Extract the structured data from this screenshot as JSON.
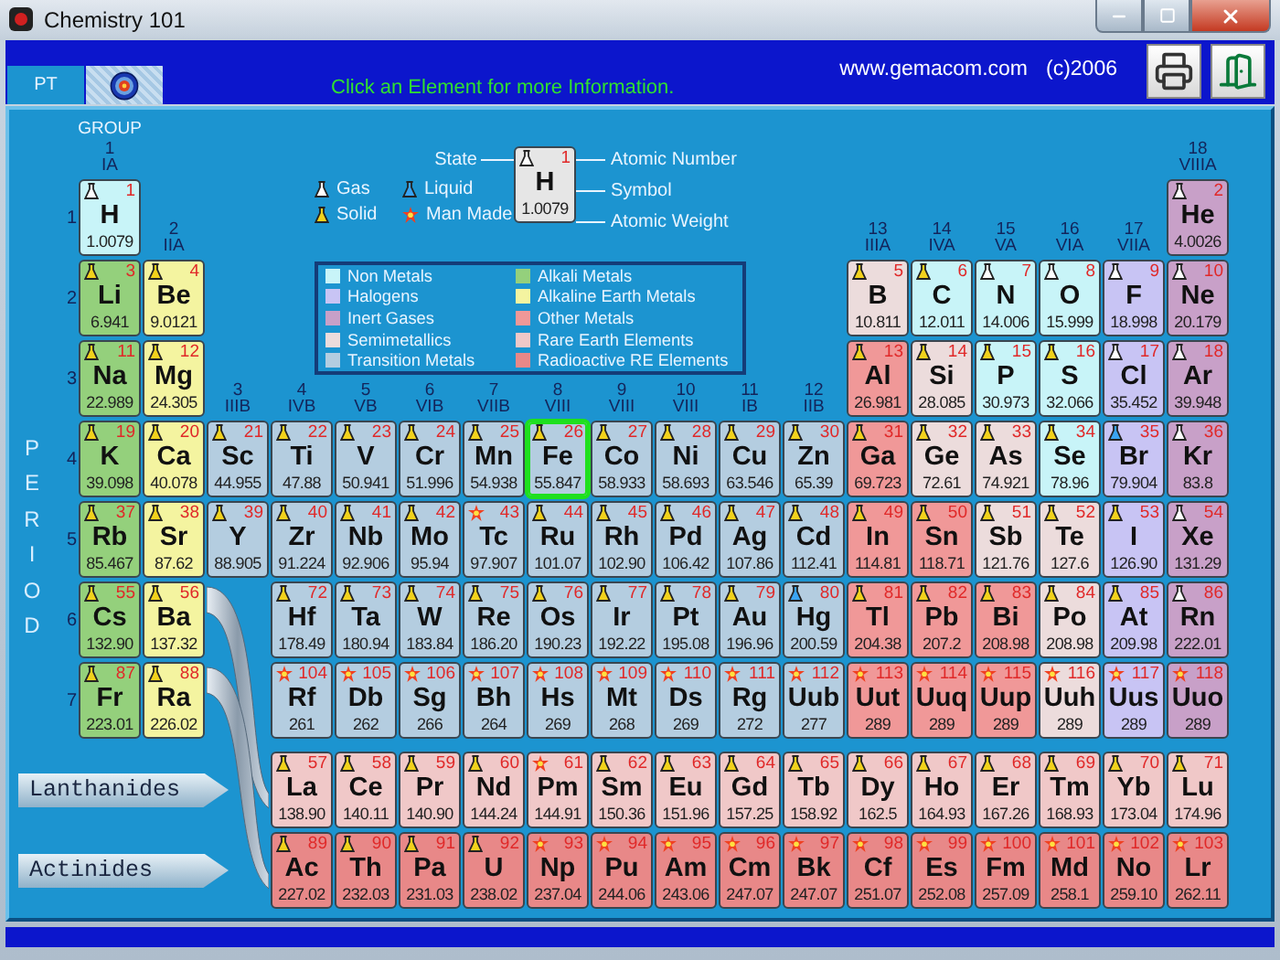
{
  "window": {
    "title": "Chemistry 101"
  },
  "tabs": [
    {
      "label": "PT",
      "selected": true
    },
    {
      "selected": false
    }
  ],
  "header": {
    "hint": "Click an Element for more Information.",
    "website": "www.gemacom.com",
    "copyright": "(c)2006"
  },
  "group_heading": "GROUP",
  "groups": [
    {
      "number": "1",
      "roman": "IA"
    },
    {
      "number": "2",
      "roman": "IIA"
    },
    {
      "number": "3",
      "roman": "IIIB"
    },
    {
      "number": "4",
      "roman": "IVB"
    },
    {
      "number": "5",
      "roman": "VB"
    },
    {
      "number": "6",
      "roman": "VIB"
    },
    {
      "number": "7",
      "roman": "VIIB"
    },
    {
      "number": "8",
      "roman": "VIII"
    },
    {
      "number": "9",
      "roman": "VIII"
    },
    {
      "number": "10",
      "roman": "VIII"
    },
    {
      "number": "11",
      "roman": "IB"
    },
    {
      "number": "12",
      "roman": "IIB"
    },
    {
      "number": "13",
      "roman": "IIIA"
    },
    {
      "number": "14",
      "roman": "IVA"
    },
    {
      "number": "15",
      "roman": "VA"
    },
    {
      "number": "16",
      "roman": "VIA"
    },
    {
      "number": "17",
      "roman": "VIIA"
    },
    {
      "number": "18",
      "roman": "VIIIA"
    }
  ],
  "period_heading": "PERIOD",
  "state_legend": [
    {
      "label": "Gas",
      "kind": "gas"
    },
    {
      "label": "Liquid",
      "kind": "liquid"
    },
    {
      "label": "Solid",
      "kind": "solid"
    },
    {
      "label": "Man Made",
      "kind": "manmade"
    }
  ],
  "key": {
    "state_label": "State",
    "number_label": "Atomic Number",
    "symbol_label": "Symbol",
    "weight_label": "Atomic Weight",
    "sample": {
      "number": "1",
      "symbol": "H",
      "weight": "1.0079",
      "kind": "gas"
    }
  },
  "legend": [
    {
      "label": "Non Metals",
      "color": "#c8f4f8"
    },
    {
      "label": "Halogens",
      "color": "#c8c4f4"
    },
    {
      "label": "Inert Gases",
      "color": "#c8a0c8"
    },
    {
      "label": "Semimetallics",
      "color": "#ecdcdc"
    },
    {
      "label": "Transition Metals",
      "color": "#b4cde0"
    },
    {
      "label": "Alkali Metals",
      "color": "#94d07c"
    },
    {
      "label": "Alkaline Earth Metals",
      "color": "#f4f4a0"
    },
    {
      "label": "Other Metals",
      "color": "#f09898"
    },
    {
      "label": "Rare Earth Elements",
      "color": "#f0c8c8"
    },
    {
      "label": "Radioactive RE Elements",
      "color": "#e88888"
    }
  ],
  "periods": [
    {
      "number": "1",
      "elements": [
        {
          "number": "1",
          "symbol": "H",
          "weight": "1.0079",
          "kind": "gas",
          "color": "#c8f4f8",
          "selected": false
        },
        {
          "number": "2",
          "symbol": "He",
          "weight": "4.0026",
          "kind": "gas",
          "color": "#c8a0c8",
          "selected": false
        }
      ]
    },
    {
      "number": "2",
      "elements": [
        {
          "number": "3",
          "symbol": "Li",
          "weight": "6.941",
          "kind": "solid",
          "color": "#94d07c",
          "selected": false
        },
        {
          "number": "4",
          "symbol": "Be",
          "weight": "9.0121",
          "kind": "solid",
          "color": "#f4f4a0",
          "selected": false
        },
        {
          "number": "5",
          "symbol": "B",
          "weight": "10.811",
          "kind": "solid",
          "color": "#ecdcdc",
          "selected": false
        },
        {
          "number": "6",
          "symbol": "C",
          "weight": "12.011",
          "kind": "solid",
          "color": "#c8f4f8",
          "selected": false
        },
        {
          "number": "7",
          "symbol": "N",
          "weight": "14.006",
          "kind": "gas",
          "color": "#c8f4f8",
          "selected": false
        },
        {
          "number": "8",
          "symbol": "O",
          "weight": "15.999",
          "kind": "gas",
          "color": "#c8f4f8",
          "selected": false
        },
        {
          "number": "9",
          "symbol": "F",
          "weight": "18.998",
          "kind": "gas",
          "color": "#c8c4f4",
          "selected": false
        },
        {
          "number": "10",
          "symbol": "Ne",
          "weight": "20.179",
          "kind": "gas",
          "color": "#c8a0c8",
          "selected": false
        }
      ]
    },
    {
      "number": "3",
      "elements": [
        {
          "number": "11",
          "symbol": "Na",
          "weight": "22.989",
          "kind": "solid",
          "color": "#94d07c",
          "selected": false
        },
        {
          "number": "12",
          "symbol": "Mg",
          "weight": "24.305",
          "kind": "solid",
          "color": "#f4f4a0",
          "selected": false
        },
        {
          "number": "13",
          "symbol": "Al",
          "weight": "26.981",
          "kind": "solid",
          "color": "#f09898",
          "selected": false
        },
        {
          "number": "14",
          "symbol": "Si",
          "weight": "28.085",
          "kind": "solid",
          "color": "#ecdcdc",
          "selected": false
        },
        {
          "number": "15",
          "symbol": "P",
          "weight": "30.973",
          "kind": "solid",
          "color": "#c8f4f8",
          "selected": false
        },
        {
          "number": "16",
          "symbol": "S",
          "weight": "32.066",
          "kind": "solid",
          "color": "#c8f4f8",
          "selected": false
        },
        {
          "number": "17",
          "symbol": "Cl",
          "weight": "35.452",
          "kind": "gas",
          "color": "#c8c4f4",
          "selected": false
        },
        {
          "number": "18",
          "symbol": "Ar",
          "weight": "39.948",
          "kind": "gas",
          "color": "#c8a0c8",
          "selected": false
        }
      ]
    },
    {
      "number": "4",
      "elements": [
        {
          "number": "19",
          "symbol": "K",
          "weight": "39.098",
          "kind": "solid",
          "color": "#94d07c",
          "selected": false
        },
        {
          "number": "20",
          "symbol": "Ca",
          "weight": "40.078",
          "kind": "solid",
          "color": "#f4f4a0",
          "selected": false
        },
        {
          "number": "21",
          "symbol": "Sc",
          "weight": "44.955",
          "kind": "solid",
          "color": "#b4cde0",
          "selected": false
        },
        {
          "number": "22",
          "symbol": "Ti",
          "weight": "47.88",
          "kind": "solid",
          "color": "#b4cde0",
          "selected": false
        },
        {
          "number": "23",
          "symbol": "V",
          "weight": "50.941",
          "kind": "solid",
          "color": "#b4cde0",
          "selected": false
        },
        {
          "number": "24",
          "symbol": "Cr",
          "weight": "51.996",
          "kind": "solid",
          "color": "#b4cde0",
          "selected": false
        },
        {
          "number": "25",
          "symbol": "Mn",
          "weight": "54.938",
          "kind": "solid",
          "color": "#b4cde0",
          "selected": false
        },
        {
          "number": "26",
          "symbol": "Fe",
          "weight": "55.847",
          "kind": "solid",
          "color": "#b4cde0",
          "selected": true
        },
        {
          "number": "27",
          "symbol": "Co",
          "weight": "58.933",
          "kind": "solid",
          "color": "#b4cde0",
          "selected": false
        },
        {
          "number": "28",
          "symbol": "Ni",
          "weight": "58.693",
          "kind": "solid",
          "color": "#b4cde0",
          "selected": false
        },
        {
          "number": "29",
          "symbol": "Cu",
          "weight": "63.546",
          "kind": "solid",
          "color": "#b4cde0",
          "selected": false
        },
        {
          "number": "30",
          "symbol": "Zn",
          "weight": "65.39",
          "kind": "solid",
          "color": "#b4cde0",
          "selected": false
        },
        {
          "number": "31",
          "symbol": "Ga",
          "weight": "69.723",
          "kind": "solid",
          "color": "#f09898",
          "selected": false
        },
        {
          "number": "32",
          "symbol": "Ge",
          "weight": "72.61",
          "kind": "solid",
          "color": "#ecdcdc",
          "selected": false
        },
        {
          "number": "33",
          "symbol": "As",
          "weight": "74.921",
          "kind": "solid",
          "color": "#ecdcdc",
          "selected": false
        },
        {
          "number": "34",
          "symbol": "Se",
          "weight": "78.96",
          "kind": "solid",
          "color": "#c8f4f8",
          "selected": false
        },
        {
          "number": "35",
          "symbol": "Br",
          "weight": "79.904",
          "kind": "liquid",
          "color": "#c8c4f4",
          "selected": false
        },
        {
          "number": "36",
          "symbol": "Kr",
          "weight": "83.8",
          "kind": "gas",
          "color": "#c8a0c8",
          "selected": false
        }
      ]
    },
    {
      "number": "5",
      "elements": [
        {
          "number": "37",
          "symbol": "Rb",
          "weight": "85.467",
          "kind": "solid",
          "color": "#94d07c",
          "selected": false
        },
        {
          "number": "38",
          "symbol": "Sr",
          "weight": "87.62",
          "kind": "solid",
          "color": "#f4f4a0",
          "selected": false
        },
        {
          "number": "39",
          "symbol": "Y",
          "weight": "88.905",
          "kind": "solid",
          "color": "#b4cde0",
          "selected": false
        },
        {
          "number": "40",
          "symbol": "Zr",
          "weight": "91.224",
          "kind": "solid",
          "color": "#b4cde0",
          "selected": false
        },
        {
          "number": "41",
          "symbol": "Nb",
          "weight": "92.906",
          "kind": "solid",
          "color": "#b4cde0",
          "selected": false
        },
        {
          "number": "42",
          "symbol": "Mo",
          "weight": "95.94",
          "kind": "solid",
          "color": "#b4cde0",
          "selected": false
        },
        {
          "number": "43",
          "symbol": "Tc",
          "weight": "97.907",
          "kind": "manmade",
          "color": "#b4cde0",
          "selected": false
        },
        {
          "number": "44",
          "symbol": "Ru",
          "weight": "101.07",
          "kind": "solid",
          "color": "#b4cde0",
          "selected": false
        },
        {
          "number": "45",
          "symbol": "Rh",
          "weight": "102.90",
          "kind": "solid",
          "color": "#b4cde0",
          "selected": false
        },
        {
          "number": "46",
          "symbol": "Pd",
          "weight": "106.42",
          "kind": "solid",
          "color": "#b4cde0",
          "selected": false
        },
        {
          "number": "47",
          "symbol": "Ag",
          "weight": "107.86",
          "kind": "solid",
          "color": "#b4cde0",
          "selected": false
        },
        {
          "number": "48",
          "symbol": "Cd",
          "weight": "112.41",
          "kind": "solid",
          "color": "#b4cde0",
          "selected": false
        },
        {
          "number": "49",
          "symbol": "In",
          "weight": "114.81",
          "kind": "solid",
          "color": "#f09898",
          "selected": false
        },
        {
          "number": "50",
          "symbol": "Sn",
          "weight": "118.71",
          "kind": "solid",
          "color": "#f09898",
          "selected": false
        },
        {
          "number": "51",
          "symbol": "Sb",
          "weight": "121.76",
          "kind": "solid",
          "color": "#ecdcdc",
          "selected": false
        },
        {
          "number": "52",
          "symbol": "Te",
          "weight": "127.6",
          "kind": "solid",
          "color": "#ecdcdc",
          "selected": false
        },
        {
          "number": "53",
          "symbol": "I",
          "weight": "126.90",
          "kind": "solid",
          "color": "#c8c4f4",
          "selected": false
        },
        {
          "number": "54",
          "symbol": "Xe",
          "weight": "131.29",
          "kind": "gas",
          "color": "#c8a0c8",
          "selected": false
        }
      ]
    },
    {
      "number": "6",
      "elements": [
        {
          "number": "55",
          "symbol": "Cs",
          "weight": "132.90",
          "kind": "solid",
          "color": "#94d07c",
          "selected": false
        },
        {
          "number": "56",
          "symbol": "Ba",
          "weight": "137.32",
          "kind": "solid",
          "color": "#f4f4a0",
          "selected": false
        },
        {
          "number": "72",
          "symbol": "Hf",
          "weight": "178.49",
          "kind": "solid",
          "color": "#b4cde0",
          "selected": false
        },
        {
          "number": "73",
          "symbol": "Ta",
          "weight": "180.94",
          "kind": "solid",
          "color": "#b4cde0",
          "selected": false
        },
        {
          "number": "74",
          "symbol": "W",
          "weight": "183.84",
          "kind": "solid",
          "color": "#b4cde0",
          "selected": false
        },
        {
          "number": "75",
          "symbol": "Re",
          "weight": "186.20",
          "kind": "solid",
          "color": "#b4cde0",
          "selected": false
        },
        {
          "number": "76",
          "symbol": "Os",
          "weight": "190.23",
          "kind": "solid",
          "color": "#b4cde0",
          "selected": false
        },
        {
          "number": "77",
          "symbol": "Ir",
          "weight": "192.22",
          "kind": "solid",
          "color": "#b4cde0",
          "selected": false
        },
        {
          "number": "78",
          "symbol": "Pt",
          "weight": "195.08",
          "kind": "solid",
          "color": "#b4cde0",
          "selected": false
        },
        {
          "number": "79",
          "symbol": "Au",
          "weight": "196.96",
          "kind": "solid",
          "color": "#b4cde0",
          "selected": false
        },
        {
          "number": "80",
          "symbol": "Hg",
          "weight": "200.59",
          "kind": "liquid",
          "color": "#b4cde0",
          "selected": false
        },
        {
          "number": "81",
          "symbol": "Tl",
          "weight": "204.38",
          "kind": "solid",
          "color": "#f09898",
          "selected": false
        },
        {
          "number": "82",
          "symbol": "Pb",
          "weight": "207.2",
          "kind": "solid",
          "color": "#f09898",
          "selected": false
        },
        {
          "number": "83",
          "symbol": "Bi",
          "weight": "208.98",
          "kind": "solid",
          "color": "#f09898",
          "selected": false
        },
        {
          "number": "84",
          "symbol": "Po",
          "weight": "208.98",
          "kind": "solid",
          "color": "#ecdcdc",
          "selected": false
        },
        {
          "number": "85",
          "symbol": "At",
          "weight": "209.98",
          "kind": "solid",
          "color": "#c8c4f4",
          "selected": false
        },
        {
          "number": "86",
          "symbol": "Rn",
          "weight": "222.01",
          "kind": "gas",
          "color": "#c8a0c8",
          "selected": false
        }
      ]
    },
    {
      "number": "7",
      "elements": [
        {
          "number": "87",
          "symbol": "Fr",
          "weight": "223.01",
          "kind": "solid",
          "color": "#94d07c",
          "selected": false
        },
        {
          "number": "88",
          "symbol": "Ra",
          "weight": "226.02",
          "kind": "solid",
          "color": "#f4f4a0",
          "selected": false
        },
        {
          "number": "104",
          "symbol": "Rf",
          "weight": "261",
          "kind": "manmade",
          "color": "#b4cde0",
          "selected": false
        },
        {
          "number": "105",
          "symbol": "Db",
          "weight": "262",
          "kind": "manmade",
          "color": "#b4cde0",
          "selected": false
        },
        {
          "number": "106",
          "symbol": "Sg",
          "weight": "266",
          "kind": "manmade",
          "color": "#b4cde0",
          "selected": false
        },
        {
          "number": "107",
          "symbol": "Bh",
          "weight": "264",
          "kind": "manmade",
          "color": "#b4cde0",
          "selected": false
        },
        {
          "number": "108",
          "symbol": "Hs",
          "weight": "269",
          "kind": "manmade",
          "color": "#b4cde0",
          "selected": false
        },
        {
          "number": "109",
          "symbol": "Mt",
          "weight": "268",
          "kind": "manmade",
          "color": "#b4cde0",
          "selected": false
        },
        {
          "number": "110",
          "symbol": "Ds",
          "weight": "269",
          "kind": "manmade",
          "color": "#b4cde0",
          "selected": false
        },
        {
          "number": "111",
          "symbol": "Rg",
          "weight": "272",
          "kind": "manmade",
          "color": "#b4cde0",
          "selected": false
        },
        {
          "number": "112",
          "symbol": "Uub",
          "weight": "277",
          "kind": "manmade",
          "color": "#b4cde0",
          "selected": false
        },
        {
          "number": "113",
          "symbol": "Uut",
          "weight": "289",
          "kind": "manmade",
          "color": "#f09898",
          "selected": false
        },
        {
          "number": "114",
          "symbol": "Uuq",
          "weight": "289",
          "kind": "manmade",
          "color": "#f09898",
          "selected": false
        },
        {
          "number": "115",
          "symbol": "Uup",
          "weight": "289",
          "kind": "manmade",
          "color": "#f09898",
          "selected": false
        },
        {
          "number": "116",
          "symbol": "Uuh",
          "weight": "289",
          "kind": "manmade",
          "color": "#ecdcdc",
          "selected": false
        },
        {
          "number": "117",
          "symbol": "Uus",
          "weight": "289",
          "kind": "manmade",
          "color": "#c8c4f4",
          "selected": false
        },
        {
          "number": "118",
          "symbol": "Uuo",
          "weight": "289",
          "kind": "manmade",
          "color": "#c8a0c8",
          "selected": false
        }
      ]
    }
  ],
  "series": [
    {
      "label": "Lanthanides",
      "elements": [
        {
          "number": "57",
          "symbol": "La",
          "weight": "138.90",
          "kind": "solid",
          "color": "#f0c8c8",
          "selected": false
        },
        {
          "number": "58",
          "symbol": "Ce",
          "weight": "140.11",
          "kind": "solid",
          "color": "#f0c8c8",
          "selected": false
        },
        {
          "number": "59",
          "symbol": "Pr",
          "weight": "140.90",
          "kind": "solid",
          "color": "#f0c8c8",
          "selected": false
        },
        {
          "number": "60",
          "symbol": "Nd",
          "weight": "144.24",
          "kind": "solid",
          "color": "#f0c8c8",
          "selected": false
        },
        {
          "number": "61",
          "symbol": "Pm",
          "weight": "144.91",
          "kind": "manmade",
          "color": "#f0c8c8",
          "selected": false
        },
        {
          "number": "62",
          "symbol": "Sm",
          "weight": "150.36",
          "kind": "solid",
          "color": "#f0c8c8",
          "selected": false
        },
        {
          "number": "63",
          "symbol": "Eu",
          "weight": "151.96",
          "kind": "solid",
          "color": "#f0c8c8",
          "selected": false
        },
        {
          "number": "64",
          "symbol": "Gd",
          "weight": "157.25",
          "kind": "solid",
          "color": "#f0c8c8",
          "selected": false
        },
        {
          "number": "65",
          "symbol": "Tb",
          "weight": "158.92",
          "kind": "solid",
          "color": "#f0c8c8",
          "selected": false
        },
        {
          "number": "66",
          "symbol": "Dy",
          "weight": "162.5",
          "kind": "solid",
          "color": "#f0c8c8",
          "selected": false
        },
        {
          "number": "67",
          "symbol": "Ho",
          "weight": "164.93",
          "kind": "solid",
          "color": "#f0c8c8",
          "selected": false
        },
        {
          "number": "68",
          "symbol": "Er",
          "weight": "167.26",
          "kind": "solid",
          "color": "#f0c8c8",
          "selected": false
        },
        {
          "number": "69",
          "symbol": "Tm",
          "weight": "168.93",
          "kind": "solid",
          "color": "#f0c8c8",
          "selected": false
        },
        {
          "number": "70",
          "symbol": "Yb",
          "weight": "173.04",
          "kind": "solid",
          "color": "#f0c8c8",
          "selected": false
        },
        {
          "number": "71",
          "symbol": "Lu",
          "weight": "174.96",
          "kind": "solid",
          "color": "#f0c8c8",
          "selected": false
        }
      ]
    },
    {
      "label": "Actinides",
      "elements": [
        {
          "number": "89",
          "symbol": "Ac",
          "weight": "227.02",
          "kind": "solid",
          "color": "#e88888",
          "selected": false
        },
        {
          "number": "90",
          "symbol": "Th",
          "weight": "232.03",
          "kind": "solid",
          "color": "#e88888",
          "selected": false
        },
        {
          "number": "91",
          "symbol": "Pa",
          "weight": "231.03",
          "kind": "solid",
          "color": "#e88888",
          "selected": false
        },
        {
          "number": "92",
          "symbol": "U",
          "weight": "238.02",
          "kind": "solid",
          "color": "#e88888",
          "selected": false
        },
        {
          "number": "93",
          "symbol": "Np",
          "weight": "237.04",
          "kind": "manmade",
          "color": "#e88888",
          "selected": false
        },
        {
          "number": "94",
          "symbol": "Pu",
          "weight": "244.06",
          "kind": "manmade",
          "color": "#e88888",
          "selected": false
        },
        {
          "number": "95",
          "symbol": "Am",
          "weight": "243.06",
          "kind": "manmade",
          "color": "#e88888",
          "selected": false
        },
        {
          "number": "96",
          "symbol": "Cm",
          "weight": "247.07",
          "kind": "manmade",
          "color": "#e88888",
          "selected": false
        },
        {
          "number": "97",
          "symbol": "Bk",
          "weight": "247.07",
          "kind": "manmade",
          "color": "#e88888",
          "selected": false
        },
        {
          "number": "98",
          "symbol": "Cf",
          "weight": "251.07",
          "kind": "manmade",
          "color": "#e88888",
          "selected": false
        },
        {
          "number": "99",
          "symbol": "Es",
          "weight": "252.08",
          "kind": "manmade",
          "color": "#e88888",
          "selected": false
        },
        {
          "number": "100",
          "symbol": "Fm",
          "weight": "257.09",
          "kind": "manmade",
          "color": "#e88888",
          "selected": false
        },
        {
          "number": "101",
          "symbol": "Md",
          "weight": "258.1",
          "kind": "manmade",
          "color": "#e88888",
          "selected": false
        },
        {
          "number": "102",
          "symbol": "No",
          "weight": "259.10",
          "kind": "manmade",
          "color": "#e88888",
          "selected": false
        },
        {
          "number": "103",
          "symbol": "Lr",
          "weight": "262.11",
          "kind": "manmade",
          "color": "#e88888",
          "selected": false
        }
      ]
    }
  ]
}
